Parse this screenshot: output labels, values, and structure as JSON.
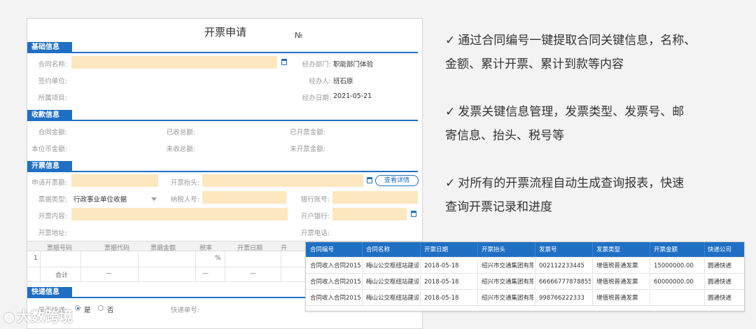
{
  "form": {
    "title": "开票申请",
    "number_label": "№",
    "sections": {
      "basic": "基础信息",
      "payment": "收款信息",
      "invoice": "开票信息",
      "express": "快递信息"
    },
    "basic": {
      "contract_name": "合同名称:",
      "signing_unit": "签约单位:",
      "project": "所属项目:",
      "dept_label": "经办部门:",
      "dept_value": "职能部门体验",
      "handler_label": "经办人:",
      "handler_value": "班石原",
      "date_label": "经办日期:",
      "date_value": "2021-05-21"
    },
    "payment": {
      "contract_amount": "合同金额:",
      "received_total": "已收总额:",
      "invoiced_amount": "已开票金额:",
      "local_amount": "本位币金额:",
      "unreceived_total": "未收总额:",
      "uninvoiced_amount": "未开票金额:"
    },
    "invoice": {
      "apply_amount": "申请开票额:",
      "invoice_header": "开票抬头:",
      "detail_btn": "查看详情",
      "bill_type_label": "票据类型:",
      "bill_type_value": "行政事业单位收据",
      "taxpayer_no": "纳税人号:",
      "bank_account": "银行账号:",
      "content": "开票内容:",
      "bank": "开户银行:",
      "address": "开票地址:",
      "phone": "开票电话:"
    },
    "table": {
      "headers": [
        "票据号码",
        "票据代码",
        "票据金额",
        "税率",
        "开票日期",
        "开"
      ],
      "row_index": "1",
      "percent": "%",
      "total_label": "合计",
      "dash": "—"
    },
    "express": {
      "need_label": "是否快递:",
      "yes": "是",
      "no": "否",
      "tracking_label": "快递单号:"
    }
  },
  "features": [
    {
      "check": "✓",
      "line1": "通过合同编号一键提取合同关键信息，名称、",
      "line2": "金额、累计开票、累计到款等内容"
    },
    {
      "check": "✓",
      "line1": "发票关键信息管理，发票类型、发票号、邮",
      "line2": "寄信息、抬头、税号等"
    },
    {
      "check": "✓",
      "line1": "对所有的开票流程自动生成查询报表，快速",
      "line2": "查询开票记录和进度"
    }
  ],
  "report": {
    "headers": [
      "合同编号",
      "合同名称",
      "开票日期",
      "开票抬头",
      "发票号",
      "发票类型",
      "开票金额",
      "快递公司"
    ],
    "rows": [
      [
        "合同收入合同20151...",
        "梅山公交枢纽站建设...",
        "2018-05-18",
        "绍兴市交通集团有限...",
        "002112233445",
        "增值税普通发票",
        "15000000.00",
        "圆通快递"
      ],
      [
        "合同收入合同20151...",
        "梅山公交枢纽站建设...",
        "2018-05-18",
        "绍兴市交通集团有限...",
        "666667778788554",
        "增值税普通发票",
        "60000000.00",
        "圆通快递"
      ],
      [
        "合同收入合同20151...",
        "梅山公交枢纽站建设...",
        "2018-05-18",
        "绍兴市交通集团有限...",
        "998766222333",
        "增值税普通发票",
        "",
        "圆通快递"
      ]
    ]
  },
  "watermark": "大数跨境",
  "colors": {
    "accent": "#1f6fc4",
    "input_bg": "#fde7bf"
  }
}
